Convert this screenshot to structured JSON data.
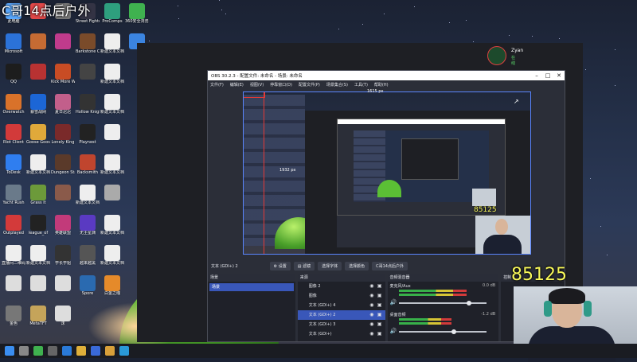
{
  "streamer_title": "C哥14点后户外",
  "user": {
    "name": "Zyan",
    "status": "在线"
  },
  "desktop_icons": [
    {
      "label": "此电脑",
      "color": "#5aa9ff",
      "col": 0,
      "row": 0
    },
    {
      "label": "",
      "color": "#e04848",
      "col": 1,
      "row": 0
    },
    {
      "label": "",
      "color": "#777",
      "col": 2,
      "row": 0
    },
    {
      "label": "Street Fighter 6",
      "color": "#334",
      "col": 3,
      "row": 0
    },
    {
      "label": "ProComps",
      "color": "#2e9f7e",
      "col": 4,
      "row": 0
    },
    {
      "label": "360安全浏览器",
      "color": "#3fb24f",
      "col": 5,
      "row": 0
    },
    {
      "label": "Microsoft",
      "color": "#2b72d8",
      "col": 0,
      "row": 1
    },
    {
      "label": "",
      "color": "#c56b33",
      "col": 1,
      "row": 1
    },
    {
      "label": "",
      "color": "#c03b8c",
      "col": 2,
      "row": 1
    },
    {
      "label": "Barkstone Company",
      "color": "#7a4b2a",
      "col": 3,
      "row": 1
    },
    {
      "label": "新建文本文档",
      "color": "#eee",
      "col": 4,
      "row": 1
    },
    {
      "label": "",
      "color": "#3b84e0",
      "col": 5,
      "row": 1
    },
    {
      "label": "QQ",
      "color": "#1d1d1d",
      "col": 0,
      "row": 2
    },
    {
      "label": "",
      "color": "#b83232",
      "col": 1,
      "row": 2
    },
    {
      "label": "Kick More Warriors",
      "color": "#c84c24",
      "col": 2,
      "row": 2
    },
    {
      "label": "",
      "color": "#444",
      "col": 3,
      "row": 2
    },
    {
      "label": "新建文本文档",
      "color": "#eee",
      "col": 4,
      "row": 2
    },
    {
      "label": "Overwatch",
      "color": "#d9722a",
      "col": 0,
      "row": 3
    },
    {
      "label": "暴雪战网",
      "color": "#1c66d6",
      "col": 1,
      "row": 3
    },
    {
      "label": "夏日迟迟",
      "color": "#c25f8b",
      "col": 2,
      "row": 3
    },
    {
      "label": "Hollow Knight",
      "color": "#333",
      "col": 3,
      "row": 3
    },
    {
      "label": "新建文本文档",
      "color": "#eee",
      "col": 4,
      "row": 3
    },
    {
      "label": "Riot Client",
      "color": "#d23a3a",
      "col": 0,
      "row": 4
    },
    {
      "label": "Goose Goose Duck",
      "color": "#e0a93a",
      "col": 1,
      "row": 4
    },
    {
      "label": "Lonely King",
      "color": "#7a2a2a",
      "col": 2,
      "row": 4
    },
    {
      "label": "Playnest",
      "color": "#222",
      "col": 3,
      "row": 4
    },
    {
      "label": "",
      "color": "#eee",
      "col": 4,
      "row": 4
    },
    {
      "label": "ToDesk",
      "color": "#2f7ef0",
      "col": 0,
      "row": 5
    },
    {
      "label": "新建文本文档",
      "color": "#eee",
      "col": 1,
      "row": 5
    },
    {
      "label": "Dungeon Stalkers",
      "color": "#5a3a2a",
      "col": 2,
      "row": 5
    },
    {
      "label": "Backsmith",
      "color": "#c0452e",
      "col": 3,
      "row": 5
    },
    {
      "label": "新建文本文档",
      "color": "#eee",
      "col": 4,
      "row": 5
    },
    {
      "label": "Yacht Rush",
      "color": "#6a7a8a",
      "col": 0,
      "row": 6
    },
    {
      "label": "Grass it",
      "color": "#6c9a3a",
      "col": 1,
      "row": 6
    },
    {
      "label": "",
      "color": "#8a5a4a",
      "col": 2,
      "row": 6
    },
    {
      "label": "新建文本文档",
      "color": "#eee",
      "col": 3,
      "row": 6
    },
    {
      "label": "",
      "color": "#aaa",
      "col": 4,
      "row": 6
    },
    {
      "label": "Outplayed",
      "color": "#d33a3a",
      "col": 0,
      "row": 7
    },
    {
      "label": "league_of",
      "color": "#222",
      "col": 1,
      "row": 7
    },
    {
      "label": "英雄联盟",
      "color": "#c23a7a",
      "col": 2,
      "row": 7
    },
    {
      "label": "无主星渊",
      "color": "#5a3ac2",
      "col": 3,
      "row": 7
    },
    {
      "label": "新建文本文档",
      "color": "#eee",
      "col": 4,
      "row": 7
    },
    {
      "label": "直播间二维码",
      "color": "#eee",
      "col": 0,
      "row": 8
    },
    {
      "label": "新建文本文档",
      "color": "#eee",
      "col": 1,
      "row": 8
    },
    {
      "label": "学长学姐",
      "color": "#333",
      "col": 2,
      "row": 8
    },
    {
      "label": "越来越黑",
      "color": "#555",
      "col": 3,
      "row": 8
    },
    {
      "label": "新建文本文档",
      "color": "#eee",
      "col": 4,
      "row": 8
    },
    {
      "label": "",
      "color": "#ddd",
      "col": 0,
      "row": 9
    },
    {
      "label": "",
      "color": "#ddd",
      "col": 1,
      "row": 9
    },
    {
      "label": "",
      "color": "#ddd",
      "col": 2,
      "row": 9
    },
    {
      "label": "Spore",
      "color": "#2a6ab0",
      "col": 3,
      "row": 9
    },
    {
      "label": "白金之魂",
      "color": "#e58a2a",
      "col": 4,
      "row": 9
    },
    {
      "label": "金色",
      "color": "#777",
      "col": 0,
      "row": 10
    },
    {
      "label": "MetaTFT",
      "color": "#c5a45a",
      "col": 1,
      "row": 10
    },
    {
      "label": "沫",
      "color": "#ddd",
      "col": 2,
      "row": 10
    }
  ],
  "obs": {
    "title": "OBS 30.2.3 - 配置文件: 未命名 - 场景: 未命名",
    "menu": [
      "文件(F)",
      "编辑(E)",
      "视图(V)",
      "停靠窗口(D)",
      "配置文件(P)",
      "场景集合(S)",
      "工具(T)",
      "帮助(H)"
    ],
    "preview_label": "1615 px",
    "inner_numbers": [
      "1932 px",
      "85125"
    ],
    "source_bar": {
      "name": "文本 (GDI+) 2",
      "buttons": [
        "设置",
        "滤镜",
        "选择字体",
        "选择颜色",
        "C哥14点后户外"
      ]
    },
    "scenes": {
      "header": "场景",
      "items": [
        "场景"
      ]
    },
    "sources": {
      "header": "来源",
      "items": [
        "图像 2",
        "图像",
        "文本 (GDI+) 4",
        "文本 (GDI+) 2",
        "文本 (GDI+) 3",
        "文本 (GDI+)"
      ],
      "selected": 3
    },
    "mixer": {
      "header": "音频混音器",
      "channels": [
        {
          "name": "麦克风/Aux",
          "db": "0.0 dB",
          "level": 0.78
        },
        {
          "name": "桌面音频",
          "db": "-1.2 dB",
          "level": 0.6
        }
      ]
    },
    "controls_header": "控制"
  },
  "overlay_number": "85125",
  "taskbar": [
    "windows",
    "search",
    "browser",
    "obs",
    "app1",
    "app2",
    "app3",
    "app4",
    "edge"
  ]
}
